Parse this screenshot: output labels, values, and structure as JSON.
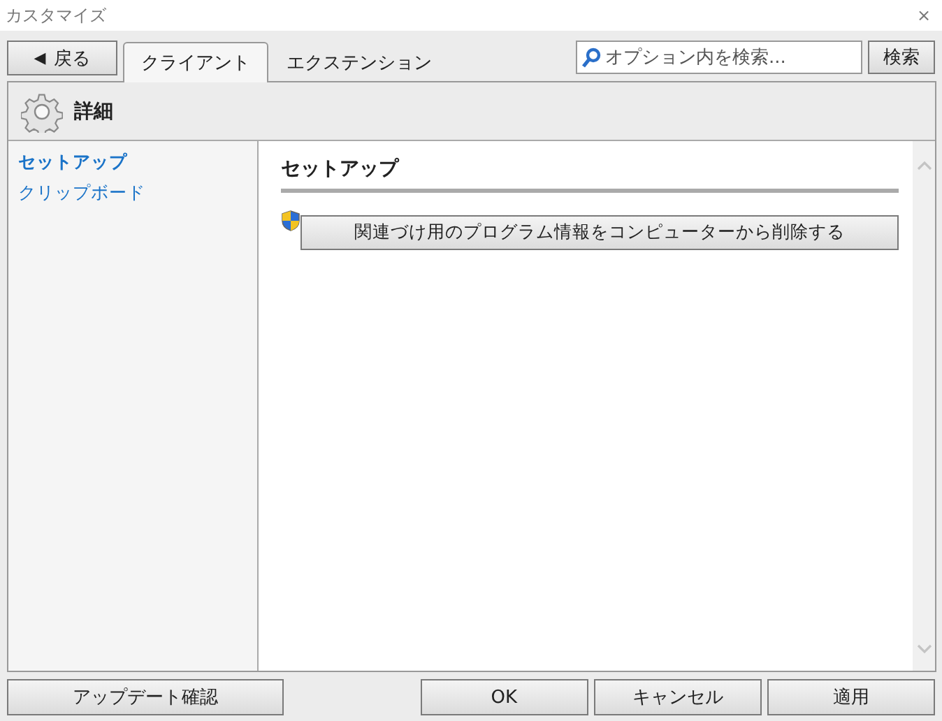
{
  "window": {
    "title": "カスタマイズ",
    "close": "×"
  },
  "toolbar": {
    "back": {
      "icon": "◀",
      "label": "戻る"
    },
    "tabs": [
      {
        "label": "クライアント",
        "selected": true
      },
      {
        "label": "エクステンション",
        "selected": false
      }
    ],
    "search": {
      "placeholder": "オプション内を検索...",
      "button": "検索"
    }
  },
  "header": {
    "title": "詳細"
  },
  "sidebar": {
    "items": [
      {
        "label": "セットアップ",
        "selected": true
      },
      {
        "label": "クリップボード",
        "selected": false
      }
    ]
  },
  "content": {
    "title": "セットアップ",
    "action": "関連づけ用のプログラム情報をコンピューターから削除する"
  },
  "footer": {
    "left": "アップデート確認",
    "buttons": [
      "OK",
      "キャンセル",
      "適用"
    ]
  }
}
